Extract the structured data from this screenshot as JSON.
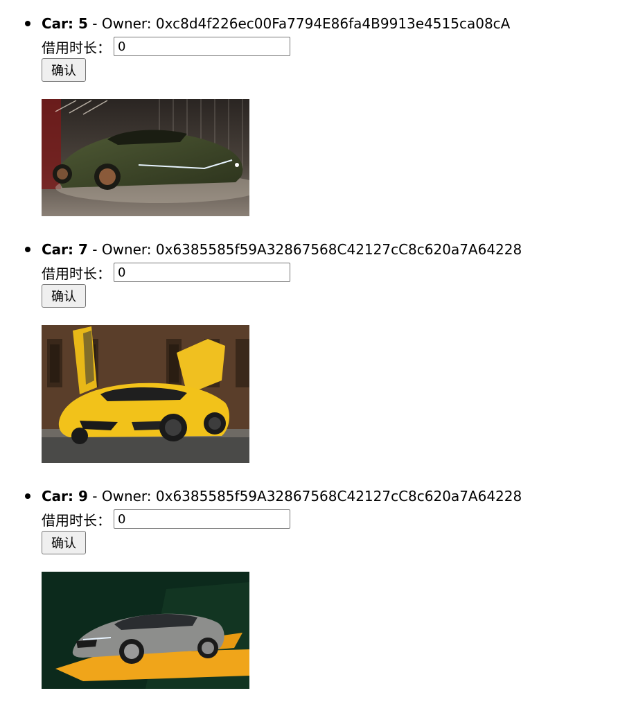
{
  "form": {
    "duration_label": "借用时长：",
    "confirm_label": "确认"
  },
  "cars": [
    {
      "car_label": "Car: 5",
      "owner_text": " - Owner: 0xc8d4f226ec00Fa7794E86fa4B9913e4515ca08cA",
      "duration_value": "0",
      "photo": "dark green sports car"
    },
    {
      "car_label": "Car: 7",
      "owner_text": " - Owner: 0x6385585f59A32867568C42127cC8c620a7A64228",
      "duration_value": "0",
      "photo": "yellow sports car with open doors"
    },
    {
      "car_label": "Car: 9",
      "owner_text": " - Owner: 0x6385585f59A32867568C42127cC8c620a7A64228",
      "duration_value": "0",
      "photo": "grey sedan on dark green background"
    }
  ]
}
